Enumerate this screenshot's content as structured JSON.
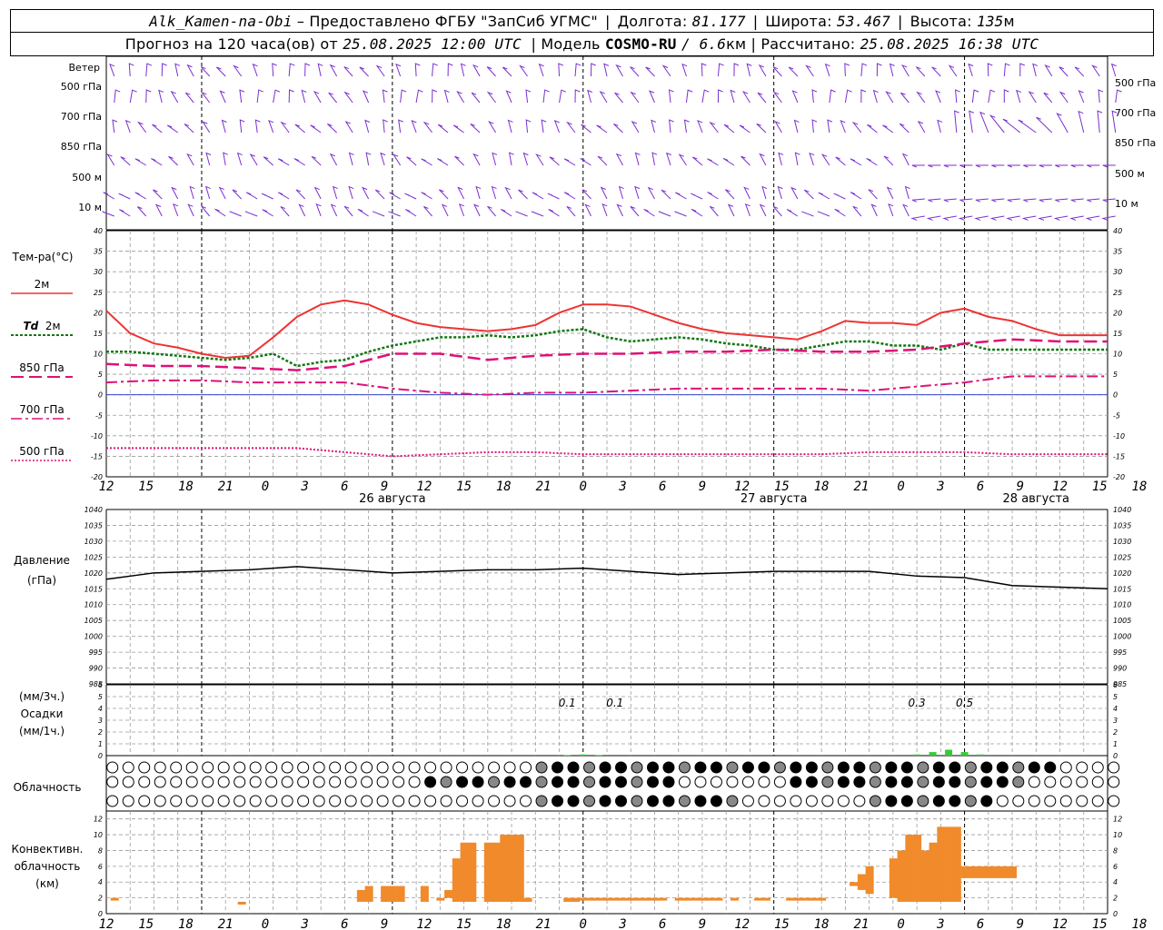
{
  "header": {
    "station": "Alk_Kamen-na-Obi",
    "provider": "– Предоставлено ФГБУ \"ЗапСиб УГМС\"",
    "lon_label": "Долгота:",
    "lon": "81.177",
    "lat_label": "Широта:",
    "lat": "53.467",
    "alt_label": "Высота:",
    "alt": "135",
    "alt_unit": "м",
    "forecast_prefix": "Прогноз на 120 часа(ов) от",
    "forecast_time": "25.08.2025 12:00 UTC",
    "model_label": "| Модель",
    "model": "COSMO-RU",
    "resolution": "/ 6.6",
    "resolution_unit": "км",
    "computed_label": "| Рассчитано:",
    "computed": "25.08.2025 16:38 UTC"
  },
  "labels": {
    "wind": "Ветер",
    "wind_levels": [
      "500 гПа",
      "700 гПа",
      "850 гПа",
      "500 м",
      "10 м"
    ],
    "temperature": "Тем-ра(°C)",
    "t2m": "2м",
    "td": "Td",
    "td_level": "2м",
    "t850": "850 гПа",
    "t700": "700 гПа",
    "t500": "500 гПа",
    "pressure": "Давление",
    "pressure_unit": "(гПа)",
    "precip_unit3": "(мм/3ч.)",
    "precip": "Осадки",
    "precip_unit1": "(мм/1ч.)",
    "cloud": "Облачность",
    "conv1": "Конвективн.",
    "conv2": "облачность",
    "conv3": "(км)"
  },
  "colors": {
    "t2m": "#ee3333",
    "td": "#117711",
    "t850": "#dd1177",
    "t700": "#dd1177",
    "t500": "#dd1177",
    "wind": "#7a2fd0",
    "precip": "#33cc33",
    "conv": "#f08a2a",
    "zero_line": "#3344cc"
  },
  "chart_data": [
    {
      "type": "line",
      "title": "Тем-ра(°C)",
      "x_unit": "hours since 25.08.2025 12:00 UTC",
      "x_tick_labels": [
        "12",
        "15",
        "18",
        "21",
        "0",
        "3",
        "6",
        "9",
        "12",
        "15",
        "18",
        "21",
        "0",
        "3",
        "6",
        "9",
        "12",
        "15",
        "18",
        "21",
        "0",
        "3",
        "6",
        "9",
        "12",
        "15",
        "18"
      ],
      "date_labels": [
        "26 августа",
        "27 августа",
        "28 августа"
      ],
      "ylim": [
        -20,
        40
      ],
      "y_ticks": [
        40,
        35,
        30,
        25,
        20,
        15,
        10,
        5,
        0,
        -5,
        -10,
        -15,
        -20
      ],
      "series": [
        {
          "name": "2м",
          "x": [
            0,
            3,
            6,
            9,
            12,
            15,
            18,
            21,
            24,
            27,
            30,
            33,
            36,
            39,
            42,
            45,
            48,
            51,
            54,
            57,
            60,
            63,
            66,
            69,
            72,
            75,
            78,
            81,
            84,
            87,
            90,
            93,
            96,
            99,
            102,
            105,
            108,
            111,
            114,
            117,
            120,
            123,
            126
          ],
          "values": [
            20.5,
            15,
            12.5,
            11.5,
            10,
            9,
            9.5,
            14,
            19,
            22,
            23,
            22,
            19.5,
            17.5,
            16.5,
            16,
            15.5,
            16,
            17,
            20,
            22,
            22,
            21.5,
            19.5,
            17.5,
            16,
            15,
            14.5,
            14,
            13.5,
            15.5,
            18,
            17.5,
            17.5,
            17,
            20,
            21,
            19,
            18,
            16,
            14.5,
            14.5,
            14.5
          ]
        },
        {
          "name": "Td 2м",
          "x": [
            0,
            3,
            6,
            9,
            12,
            15,
            18,
            21,
            24,
            27,
            30,
            33,
            36,
            39,
            42,
            45,
            48,
            51,
            54,
            57,
            60,
            63,
            66,
            69,
            72,
            75,
            78,
            81,
            84,
            87,
            90,
            93,
            96,
            99,
            102,
            105,
            108,
            111,
            114,
            117,
            120,
            123,
            126
          ],
          "values": [
            10.5,
            10.5,
            10,
            9.5,
            9,
            8.5,
            9,
            10,
            7,
            8,
            8.5,
            10.5,
            12,
            13,
            14,
            14,
            14.5,
            14,
            14.5,
            15.5,
            16,
            14,
            13,
            13.5,
            14,
            13.5,
            12.5,
            12,
            11,
            11,
            12,
            13,
            13,
            12,
            12,
            11,
            12.5,
            11,
            11,
            11,
            11,
            11,
            11
          ]
        },
        {
          "name": "850 гПа",
          "x": [
            0,
            6,
            12,
            18,
            24,
            30,
            36,
            42,
            48,
            54,
            60,
            66,
            72,
            78,
            84,
            90,
            96,
            102,
            108,
            114,
            120,
            126
          ],
          "values": [
            7.5,
            7,
            7,
            6.5,
            6,
            7,
            10,
            10,
            8.5,
            9.5,
            10,
            10,
            10.5,
            10.5,
            11,
            10.5,
            10.5,
            11,
            12.5,
            13.5,
            13,
            13
          ]
        },
        {
          "name": "700 гПа",
          "x": [
            0,
            6,
            12,
            18,
            24,
            30,
            36,
            42,
            48,
            54,
            60,
            66,
            72,
            78,
            84,
            90,
            96,
            102,
            108,
            114,
            120,
            126
          ],
          "values": [
            3,
            3.5,
            3.5,
            3,
            3,
            3,
            1.5,
            0.5,
            0,
            0.5,
            0.5,
            1,
            1.5,
            1.5,
            1.5,
            1.5,
            1,
            2,
            3,
            4.5,
            4.5,
            4.5
          ]
        },
        {
          "name": "500 гПа",
          "x": [
            0,
            6,
            12,
            18,
            24,
            30,
            36,
            42,
            48,
            54,
            60,
            66,
            72,
            78,
            84,
            90,
            96,
            102,
            108,
            114,
            120,
            126
          ],
          "values": [
            -13,
            -13,
            -13,
            -13,
            -13,
            -14,
            -15,
            -14.5,
            -14,
            -14,
            -14.5,
            -14.5,
            -14.5,
            -14.5,
            -14.5,
            -14.5,
            -14,
            -14,
            -14,
            -14.5,
            -14.5,
            -14.5
          ]
        }
      ]
    },
    {
      "type": "line",
      "title": "Давление (гПа)",
      "ylim": [
        985,
        1040
      ],
      "y_ticks": [
        1040,
        1035,
        1030,
        1025,
        1020,
        1015,
        1010,
        1005,
        1000,
        995,
        990,
        985
      ],
      "series": [
        {
          "name": "Давление",
          "x": [
            0,
            6,
            12,
            18,
            24,
            30,
            36,
            42,
            48,
            54,
            60,
            66,
            72,
            78,
            84,
            90,
            96,
            102,
            108,
            114,
            120,
            126
          ],
          "values": [
            1018,
            1020,
            1020.5,
            1021,
            1022,
            1021,
            1020,
            1020.5,
            1021,
            1021,
            1021.5,
            1020.5,
            1019.5,
            1020,
            1020.5,
            1020.5,
            1020.5,
            1019,
            1018.5,
            1016,
            1015.5,
            1015
          ]
        }
      ]
    },
    {
      "type": "bar",
      "title": "Осадки",
      "ylim": [
        0,
        6
      ],
      "y_ticks": [
        6,
        5,
        4,
        3,
        2,
        1,
        0
      ],
      "annotations": [
        "0.1",
        "0.1",
        "0.3",
        "0.5"
      ],
      "series": [
        {
          "name": "мм/1ч",
          "x": [
            58,
            60,
            62,
            102,
            104,
            106,
            108,
            110
          ],
          "values": [
            0.05,
            0.1,
            0.05,
            0.1,
            0.3,
            0.5,
            0.3,
            0.1
          ]
        }
      ]
    },
    {
      "type": "bar",
      "title": "Конвективн. облачность (км)",
      "ylim": [
        0,
        13
      ],
      "y_ticks": [
        12,
        10,
        8,
        6,
        4,
        2,
        0
      ],
      "series": [
        {
          "name": "облачность",
          "x": [
            1,
            17,
            32,
            33,
            35,
            36,
            37,
            40,
            42,
            43,
            44,
            45,
            46,
            48,
            49,
            50,
            51,
            52,
            53,
            58,
            59,
            60,
            61,
            62,
            63,
            64,
            65,
            66,
            67,
            68,
            69,
            70,
            72,
            73,
            74,
            75,
            76,
            77,
            79,
            82,
            83,
            86,
            87,
            88,
            89,
            90,
            94,
            95,
            96,
            99,
            100,
            101,
            102,
            103,
            104,
            105,
            106,
            107,
            108,
            109,
            110,
            111,
            112,
            113,
            114
          ],
          "values": [
            [
              2,
              2
            ],
            [
              1.5,
              1.5
            ],
            [
              1.5,
              3
            ],
            [
              1.5,
              3.5
            ],
            [
              1.5,
              3.5
            ],
            [
              1.5,
              3.5
            ],
            [
              1.5,
              3.5
            ],
            [
              1.5,
              3.5
            ],
            [
              2,
              2
            ],
            [
              2,
              3
            ],
            [
              1.5,
              7
            ],
            [
              1.5,
              9
            ],
            [
              1.5,
              9
            ],
            [
              1.5,
              9
            ],
            [
              1.5,
              9
            ],
            [
              1.5,
              10
            ],
            [
              1.5,
              10
            ],
            [
              1.5,
              10
            ],
            [
              1.5,
              2
            ],
            [
              1.5,
              2
            ],
            [
              1.5,
              2
            ],
            [
              2,
              2
            ],
            [
              2,
              2
            ],
            [
              2,
              2
            ],
            [
              2,
              2
            ],
            [
              2,
              2
            ],
            [
              2,
              2
            ],
            [
              2,
              2
            ],
            [
              2,
              2
            ],
            [
              2,
              2
            ],
            [
              2,
              2
            ],
            [
              2,
              2
            ],
            [
              2,
              2
            ],
            [
              2,
              2
            ],
            [
              2,
              2
            ],
            [
              2,
              2
            ],
            [
              2,
              2
            ],
            [
              2,
              2
            ],
            [
              2,
              2
            ],
            [
              2,
              2
            ],
            [
              2,
              2
            ],
            [
              2,
              2
            ],
            [
              2,
              2
            ],
            [
              2,
              2
            ],
            [
              2,
              2
            ],
            [
              2,
              2
            ],
            [
              3.5,
              4
            ],
            [
              3,
              5
            ],
            [
              2.5,
              6
            ],
            [
              2,
              7
            ],
            [
              1.5,
              8
            ],
            [
              1.5,
              10
            ],
            [
              1.5,
              10
            ],
            [
              1.5,
              8
            ],
            [
              1.5,
              9
            ],
            [
              1.5,
              11
            ],
            [
              1.5,
              11
            ],
            [
              1.5,
              11
            ],
            [
              4.5,
              6
            ],
            [
              4.5,
              6
            ],
            [
              4.5,
              6
            ],
            [
              4.5,
              6
            ],
            [
              4.5,
              6
            ],
            [
              4.5,
              6
            ],
            [
              4.5,
              6
            ]
          ]
        }
      ]
    }
  ]
}
